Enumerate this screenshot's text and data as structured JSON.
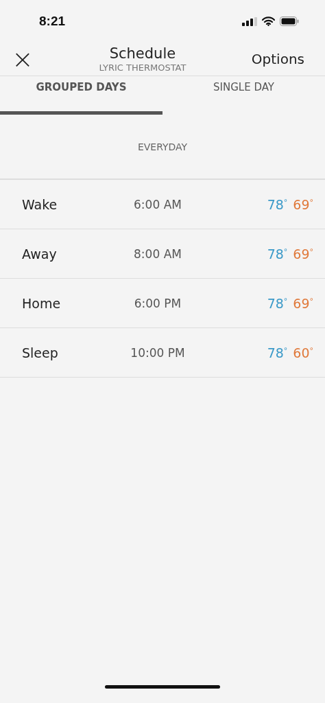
{
  "status_bar": {
    "time": "8:21"
  },
  "header": {
    "close": "×",
    "title": "Schedule",
    "subtitle": "LYRIC THERMOSTAT",
    "action": "Options"
  },
  "tabs": [
    {
      "label": "GROUPED DAYS",
      "selected": true
    },
    {
      "label": "SINGLE DAY",
      "selected": false
    }
  ],
  "section": "EVERYDAY",
  "periods": [
    {
      "name": "Wake",
      "time": "6:00 AM",
      "cool": "78$^{°}$",
      "heat": "69$^{°}$"
    },
    {
      "name": "Away",
      "time": "8:00 AM",
      "cool": "78$^{°}$",
      "heat": "69$^{°}$"
    },
    {
      "name": "Home",
      "time": "6:00 PM",
      "cool": "78$^{°}$",
      "heat": "69$^{°}$"
    },
    {
      "name": "Sleep",
      "time": "10:00 PM",
      "cool": "78$^{°}$",
      "heat": "60$^{°}$"
    }
  ]
}
